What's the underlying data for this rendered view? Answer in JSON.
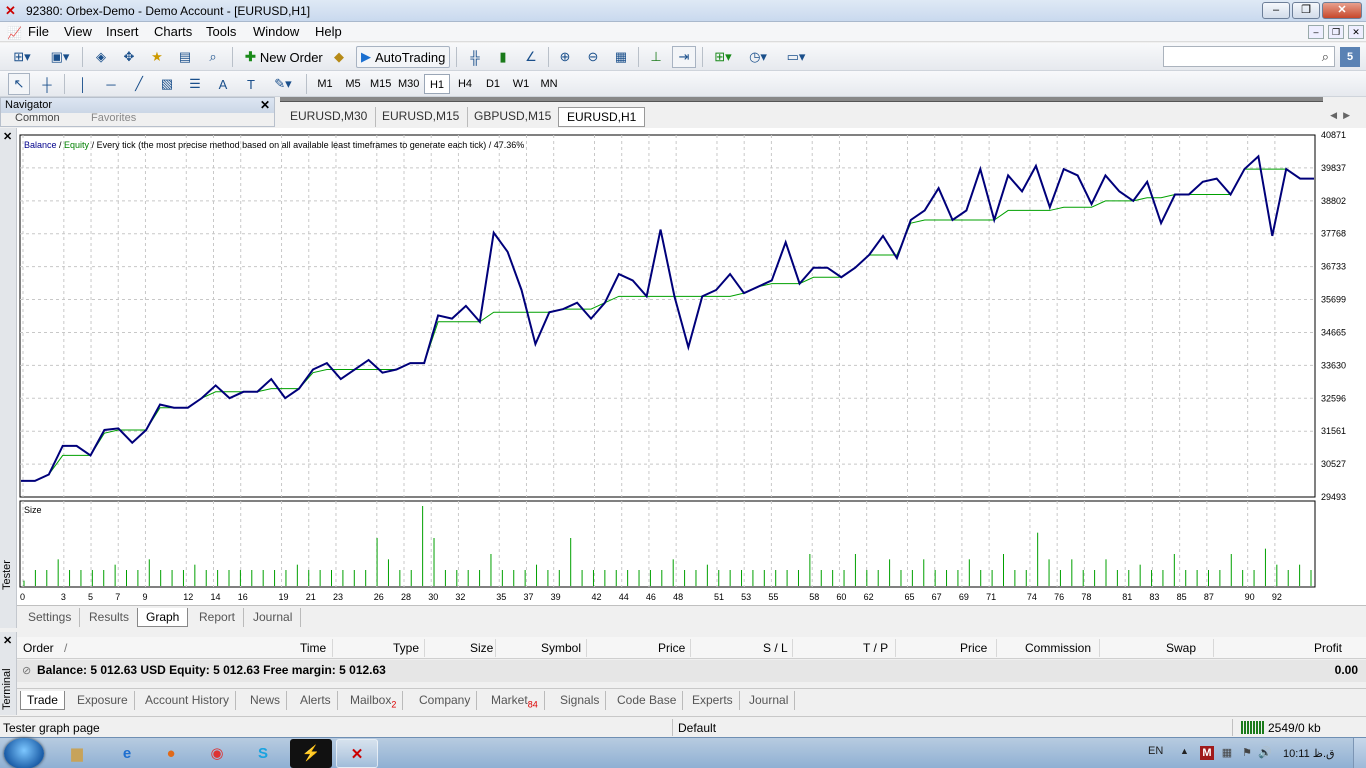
{
  "window": {
    "title": "92380: Orbex-Demo - Demo Account - [EURUSD,H1]",
    "min": "–",
    "restore": "❐",
    "close": "✕"
  },
  "menu": [
    "File",
    "View",
    "Insert",
    "Charts",
    "Tools",
    "Window",
    "Help"
  ],
  "toolbar": {
    "new_order": "New Order",
    "autotrading": "AutoTrading",
    "search_placeholder": "",
    "notif_count": "5"
  },
  "timeframes": [
    "M1",
    "M5",
    "M15",
    "M30",
    "H1",
    "H4",
    "D1",
    "W1",
    "MN"
  ],
  "active_timeframe": "H1",
  "navigator": {
    "title": "Navigator",
    "tabs": [
      "Common",
      "Favorites"
    ]
  },
  "chart_tabs": [
    "EURUSD,M30",
    "EURUSD,M15",
    "GBPUSD,M15",
    "EURUSD,H1"
  ],
  "active_chart_tab": "EURUSD,H1",
  "graph": {
    "legend_balance": "Balance",
    "legend_slash": " / ",
    "legend_equity": "Equity",
    "legend_rest": " / Every tick (the most precise method based on all available least timeframes to generate each tick) / 47.36%",
    "size_label": "Size"
  },
  "chart_data": {
    "type": "line",
    "title": "",
    "ylim": [
      29493,
      40871
    ],
    "y_ticks": [
      40871,
      39837,
      38802,
      37768,
      36733,
      35699,
      34665,
      33630,
      32596,
      31561,
      30527,
      29493
    ],
    "x_ticks": [
      0,
      3,
      5,
      7,
      9,
      12,
      14,
      16,
      19,
      21,
      23,
      26,
      28,
      30,
      32,
      35,
      37,
      39,
      42,
      44,
      46,
      48,
      51,
      53,
      55,
      58,
      60,
      62,
      65,
      67,
      69,
      71,
      74,
      76,
      78,
      81,
      83,
      85,
      87,
      90,
      92
    ],
    "series": [
      {
        "name": "Balance",
        "color": "#000080",
        "values": [
          30000,
          30000,
          30200,
          31100,
          31100,
          30800,
          31600,
          31650,
          31200,
          31600,
          32400,
          32300,
          32300,
          32600,
          33000,
          32600,
          32800,
          32800,
          33200,
          32600,
          32900,
          33500,
          33700,
          33200,
          33500,
          33800,
          33400,
          33500,
          33700,
          33700,
          35200,
          35100,
          35500,
          35000,
          37800,
          37200,
          36000,
          34300,
          35300,
          35400,
          35600,
          35100,
          35600,
          36500,
          36300,
          35800,
          37900,
          35800,
          34200,
          35800,
          36000,
          36500,
          35900,
          36100,
          36300,
          37500,
          36200,
          36700,
          36700,
          36400,
          36700,
          37100,
          37700,
          37000,
          38200,
          38500,
          39200,
          38200,
          38500,
          39800,
          38200,
          39600,
          39100,
          39900,
          38600,
          39800,
          39600,
          38700,
          39600,
          39100,
          38800,
          39400,
          38100,
          39000,
          39000,
          39400,
          39500,
          39000,
          39800,
          40200,
          37700,
          39800,
          39500,
          39500
        ],
        "note": ""
      },
      {
        "name": "Equity",
        "color": "#008000",
        "values": [
          30000,
          30000,
          30200,
          30800,
          30800,
          30800,
          31500,
          31600,
          31600,
          31600,
          32300,
          32300,
          32300,
          32600,
          32800,
          32800,
          32800,
          32800,
          32900,
          32900,
          32900,
          33400,
          33500,
          33500,
          33500,
          33500,
          33500,
          33500,
          33700,
          33700,
          35000,
          35000,
          35000,
          35000,
          35300,
          35300,
          35300,
          35300,
          35300,
          35400,
          35400,
          35400,
          35600,
          35800,
          35800,
          35800,
          35800,
          35800,
          35800,
          35800,
          35800,
          35800,
          35900,
          36100,
          36200,
          36200,
          36200,
          36400,
          36400,
          36400,
          36700,
          37100,
          37100,
          37100,
          38100,
          38200,
          38200,
          38200,
          38200,
          38200,
          38200,
          38500,
          38500,
          38500,
          38500,
          38600,
          38600,
          38600,
          38800,
          38800,
          38800,
          38900,
          38900,
          39000,
          39000,
          39000,
          39000,
          39000,
          39800,
          39800,
          39800,
          39800,
          39500,
          39500
        ]
      }
    ],
    "size_bars": [
      1,
      3,
      3,
      5,
      3,
      3,
      3,
      3,
      4,
      3,
      3,
      5,
      3,
      3,
      3,
      4,
      3,
      3,
      3,
      3,
      3,
      3,
      3,
      3,
      4,
      3,
      3,
      3,
      3,
      3,
      3,
      9,
      5,
      3,
      3,
      15,
      9,
      3,
      3,
      3,
      3,
      6,
      3,
      3,
      3,
      4,
      3,
      3,
      9,
      3,
      3,
      3,
      3,
      3,
      3,
      3,
      3,
      5,
      3,
      3,
      4,
      3,
      3,
      3,
      3,
      3,
      3,
      3,
      3,
      6,
      3,
      3,
      3,
      6,
      3,
      3,
      5,
      3,
      3,
      5,
      3,
      3,
      3,
      5,
      3,
      3,
      6,
      3,
      3,
      10,
      5,
      3,
      5,
      3,
      3,
      5,
      3,
      3,
      4,
      3,
      3,
      6,
      3,
      3,
      3,
      3,
      6,
      3,
      3,
      7,
      4,
      3,
      4,
      3
    ],
    "grid": true
  },
  "tester_tabs": [
    "Settings",
    "Results",
    "Graph",
    "Report",
    "Journal"
  ],
  "active_tester_tab": "Graph",
  "tester_label": "Tester",
  "orders": {
    "columns": [
      "Order",
      "/",
      "Time",
      "Type",
      "Size",
      "Symbol",
      "Price",
      "S / L",
      "T / P",
      "Price",
      "Commission",
      "Swap",
      "Profit"
    ],
    "balance_line": "Balance: 5 012.63 USD  Equity: 5 012.63  Free margin: 5 012.63",
    "profit": "0.00"
  },
  "terminal_tabs": [
    {
      "label": "Trade",
      "badge": ""
    },
    {
      "label": "Exposure",
      "badge": ""
    },
    {
      "label": "Account History",
      "badge": ""
    },
    {
      "label": "News",
      "badge": ""
    },
    {
      "label": "Alerts",
      "badge": ""
    },
    {
      "label": "Mailbox",
      "badge": "2"
    },
    {
      "label": "Company",
      "badge": ""
    },
    {
      "label": "Market",
      "badge": "84"
    },
    {
      "label": "Signals",
      "badge": ""
    },
    {
      "label": "Code Base",
      "badge": ""
    },
    {
      "label": "Experts",
      "badge": ""
    },
    {
      "label": "Journal",
      "badge": ""
    }
  ],
  "terminal_label": "Terminal",
  "status": {
    "text": "Tester graph page",
    "profile": "Default",
    "connection": "2549/0 kb"
  },
  "taskbar": {
    "lang": "EN",
    "clock": "10:11 ق.ظ"
  }
}
